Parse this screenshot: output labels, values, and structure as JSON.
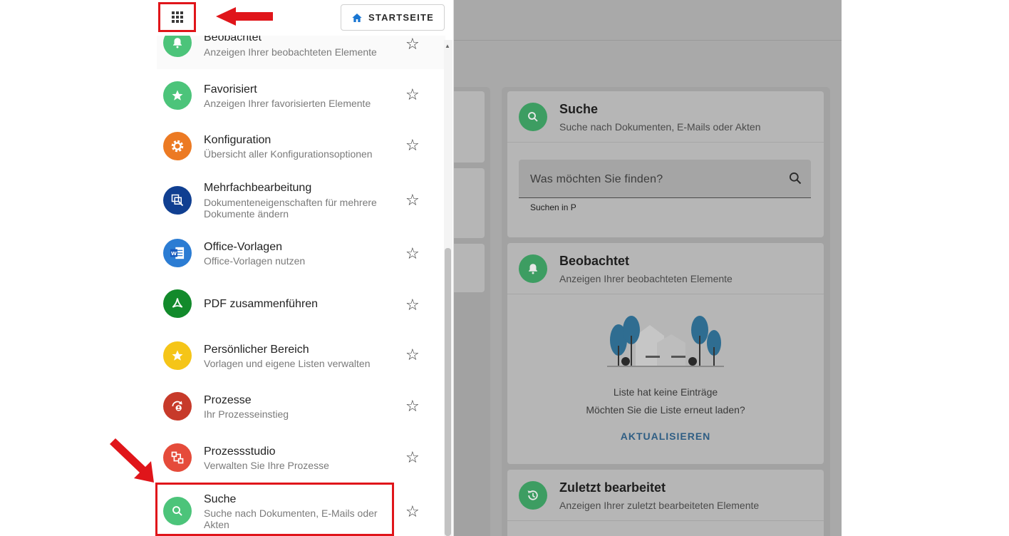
{
  "header": {
    "home_label": "STARTSEITE"
  },
  "drawer": {
    "items": [
      {
        "title": "Beobachtet",
        "subtitle": "Anzeigen Ihrer beobachteten Elemente",
        "icon": "bell-icon",
        "color": "#4cc47a"
      },
      {
        "title": "Favorisiert",
        "subtitle": "Anzeigen Ihrer favorisierten Elemente",
        "icon": "star-icon",
        "color": "#4cc47a"
      },
      {
        "title": "Konfiguration",
        "subtitle": "Übersicht aller Konfigurationsoptionen",
        "icon": "gear-icon",
        "color": "#ec7a23"
      },
      {
        "title": "Mehrfachbearbeitung",
        "subtitle": "Dokumenteneigenschaften für mehrere Dokumente ändern",
        "icon": "multi-edit-icon",
        "color": "#103f91"
      },
      {
        "title": "Office-Vorlagen",
        "subtitle": "Office-Vorlagen nutzen",
        "icon": "word-icon",
        "color": "#2b7cd3"
      },
      {
        "title": "PDF zusammenführen",
        "subtitle": "",
        "icon": "pdf-icon",
        "color": "#128a2b"
      },
      {
        "title": "Persönlicher Bereich",
        "subtitle": "Vorlagen und eigene Listen verwalten",
        "icon": "star-icon",
        "color": "#f5c518"
      },
      {
        "title": "Prozesse",
        "subtitle": "Ihr Prozesseinstieg",
        "icon": "process-icon",
        "color": "#c73a2a"
      },
      {
        "title": "Prozessstudio",
        "subtitle": "Verwalten Sie Ihre Prozesse",
        "icon": "workflow-icon",
        "color": "#e54b3a"
      },
      {
        "title": "Suche",
        "subtitle": "Suche nach Dokumenten, E-Mails oder Akten",
        "icon": "search-icon",
        "color": "#4cc47a"
      }
    ]
  },
  "cards": {
    "search": {
      "title": "Suche",
      "subtitle": "Suche nach Dokumenten, E-Mails oder Akten",
      "placeholder": "Was möchten Sie finden?",
      "hint": "Suchen in P"
    },
    "watched": {
      "title": "Beobachtet",
      "subtitle": "Anzeigen Ihrer beobachteten Elemente",
      "empty_title": "Liste hat keine Einträge",
      "empty_question": "Möchten Sie die Liste erneut laden?",
      "reload": "AKTUALISIEREN"
    },
    "recent": {
      "title": "Zuletzt bearbeitet",
      "subtitle": "Anzeigen Ihrer zuletzt bearbeiteten Elemente"
    }
  },
  "colors": {
    "annotation": "#e0151a",
    "accent_blue": "#2f5e84"
  }
}
